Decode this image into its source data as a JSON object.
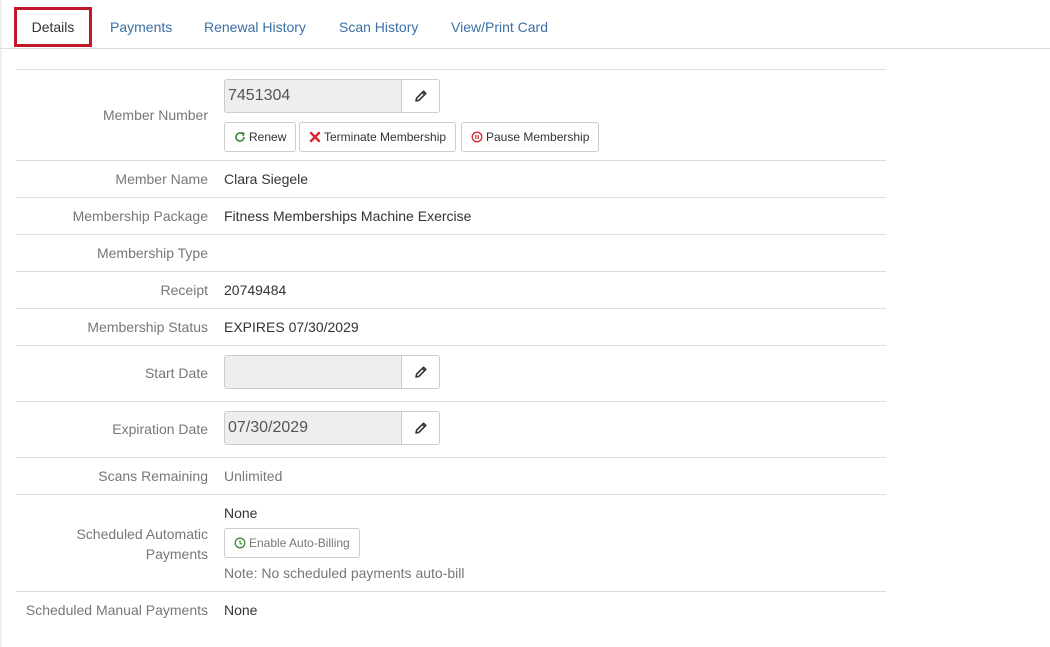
{
  "tabs": [
    {
      "label": "Details",
      "active": true
    },
    {
      "label": "Payments"
    },
    {
      "label": "Renewal History"
    },
    {
      "label": "Scan History"
    },
    {
      "label": "View/Print Card"
    }
  ],
  "details": {
    "member_number": {
      "label": "Member Number",
      "value": "7451304"
    },
    "actions": {
      "renew": "Renew",
      "terminate": "Terminate Membership",
      "pause": "Pause Membership"
    },
    "member_name": {
      "label": "Member Name",
      "value": "Clara Siegele"
    },
    "membership_package": {
      "label": "Membership Package",
      "value": "Fitness Memberships Machine Exercise"
    },
    "membership_type": {
      "label": "Membership Type",
      "value": ""
    },
    "receipt": {
      "label": "Receipt",
      "value": "20749484"
    },
    "membership_status": {
      "label": "Membership Status",
      "value": "EXPIRES 07/30/2029"
    },
    "start_date": {
      "label": "Start Date",
      "value": ""
    },
    "expiration_date": {
      "label": "Expiration Date",
      "value": "07/30/2029"
    },
    "scans_remaining": {
      "label": "Scans Remaining",
      "value": "Unlimited"
    },
    "scheduled_automatic_payments": {
      "label_line1": "Scheduled Automatic",
      "label_line2": "Payments",
      "value": "None",
      "button": "Enable Auto-Billing",
      "note": "Note: No scheduled payments auto-bill"
    },
    "scheduled_manual_payments": {
      "label": "Scheduled Manual Payments",
      "value": "None"
    }
  },
  "colors": {
    "accent": "#3b6fa5",
    "active_tab_border": "#c0172b",
    "status_green": "#3c8a3c",
    "terminate_red": "#d9262b"
  },
  "icons": {
    "edit": "pencil-icon",
    "renew": "refresh-icon",
    "terminate": "x-icon",
    "pause": "pause-circle-icon",
    "auto_billing": "clock-icon"
  }
}
